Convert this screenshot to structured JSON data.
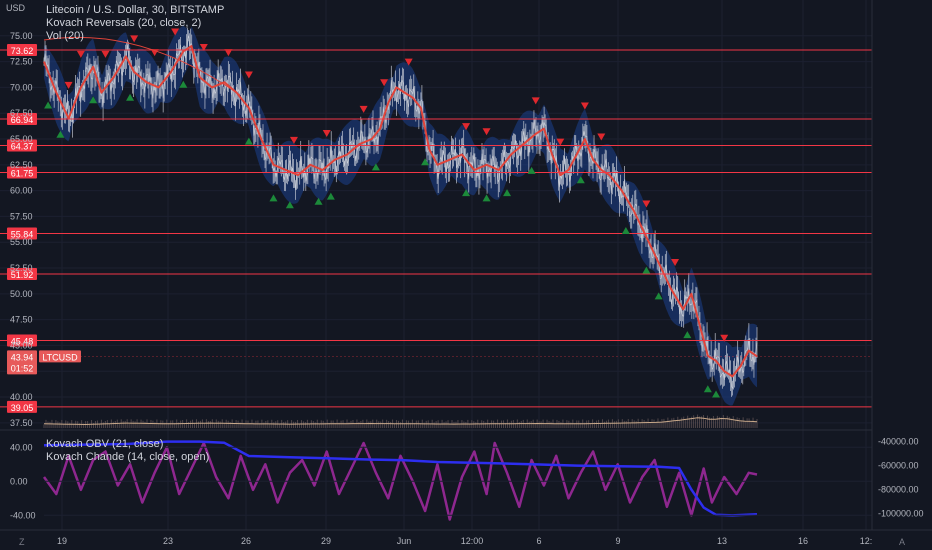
{
  "header": {
    "symbol_title": "Litecoin / U.S. Dollar, 30, BITSTAMP",
    "indicator_reversals": "Kovach Reversals (20, close, 2)",
    "indicator_volume": "Vol (20)"
  },
  "lower_pane": {
    "indicator_obv": "Kovach OBV (21, close)",
    "indicator_chande": "Kovach Chande (14, close, open)"
  },
  "price_axis": {
    "unit": "USD",
    "ticks": [
      "75.00",
      "72.50",
      "70.00",
      "67.50",
      "65.00",
      "62.50",
      "60.00",
      "57.50",
      "55.00",
      "52.50",
      "50.00",
      "47.50",
      "45.00",
      "42.50",
      "40.00",
      "37.50"
    ],
    "level_labels": [
      "73.62",
      "66.94",
      "64.37",
      "61.75",
      "55.84",
      "51.92",
      "45.48",
      "39.05"
    ],
    "current_price": "43.94",
    "symbol_badge": "LTCUSD",
    "countdown": "01:52"
  },
  "lower_axis": {
    "left_ticks": [
      "40.00",
      "0.00",
      "-40.00"
    ],
    "right_ticks": [
      "-40000.00",
      "-60000.00",
      "-80000.00",
      "-100000.00"
    ]
  },
  "time_axis": {
    "labels": [
      "19",
      "23",
      "26",
      "29",
      "Jun",
      "12:00",
      "6",
      "9",
      "13",
      "16",
      "12:"
    ]
  },
  "corner": {
    "left": "Z",
    "right": "A"
  },
  "colors": {
    "background": "#131722",
    "level_line": "#f23645",
    "candle_line": "#cfd3dc",
    "trend_line": "#e0443a",
    "band_fill": "#1c3f8c",
    "up_triangle": "#1c8a3a",
    "down_triangle": "#e0282e",
    "obv_line": "#2d2ef0",
    "chande_line": "#8e278f"
  },
  "chart_data": {
    "type": "line",
    "symbol": "LTCUSD",
    "interval": "30",
    "exchange": "BITSTAMP",
    "y_range": [
      37,
      77.5
    ],
    "horizontal_levels": [
      73.62,
      66.94,
      64.37,
      61.75,
      55.84,
      51.92,
      45.48,
      39.05
    ],
    "price_path": [
      [
        0,
        72.5
      ],
      [
        3,
        69.5
      ],
      [
        6,
        67.0
      ],
      [
        9,
        70.0
      ],
      [
        12,
        72.0
      ],
      [
        14,
        69.5
      ],
      [
        17,
        71.0
      ],
      [
        20,
        73.0
      ],
      [
        22,
        71.5
      ],
      [
        25,
        70.5
      ],
      [
        28,
        70.0
      ],
      [
        31,
        71.5
      ],
      [
        34,
        73.5
      ],
      [
        36,
        74.0
      ],
      [
        38,
        71.0
      ],
      [
        41,
        70.0
      ],
      [
        44,
        70.5
      ],
      [
        47,
        69.5
      ],
      [
        50,
        68.0
      ],
      [
        53,
        65.0
      ],
      [
        56,
        62.5
      ],
      [
        59,
        62.0
      ],
      [
        62,
        61.5
      ],
      [
        65,
        62.5
      ],
      [
        68,
        62.0
      ],
      [
        71,
        63.0
      ],
      [
        74,
        63.5
      ],
      [
        77,
        64.5
      ],
      [
        80,
        65.0
      ],
      [
        82,
        66.0
      ],
      [
        84,
        68.5
      ],
      [
        86,
        70.0
      ],
      [
        88,
        69.5
      ],
      [
        90,
        69.0
      ],
      [
        92,
        68.0
      ],
      [
        94,
        64.0
      ],
      [
        96,
        62.5
      ],
      [
        99,
        63.0
      ],
      [
        102,
        63.5
      ],
      [
        105,
        62.0
      ],
      [
        108,
        62.5
      ],
      [
        111,
        62.0
      ],
      [
        114,
        63.5
      ],
      [
        117,
        64.5
      ],
      [
        120,
        65.5
      ],
      [
        122,
        66.0
      ],
      [
        124,
        63.5
      ],
      [
        126,
        61.5
      ],
      [
        128,
        62.0
      ],
      [
        130,
        63.5
      ],
      [
        132,
        65.0
      ],
      [
        134,
        63.0
      ],
      [
        136,
        62.0
      ],
      [
        138,
        61.5
      ],
      [
        141,
        60.0
      ],
      [
        144,
        58.0
      ],
      [
        147,
        55.5
      ],
      [
        150,
        53.0
      ],
      [
        153,
        50.5
      ],
      [
        156,
        48.5
      ],
      [
        158,
        50.0
      ],
      [
        160,
        47.0
      ],
      [
        162,
        44.0
      ],
      [
        164,
        43.5
      ],
      [
        166,
        42.5
      ],
      [
        168,
        42.0
      ],
      [
        170,
        43.0
      ],
      [
        172,
        44.5
      ],
      [
        174,
        43.94
      ]
    ],
    "volume_series": [
      [
        0,
        0.3
      ],
      [
        10,
        0.25
      ],
      [
        20,
        0.35
      ],
      [
        30,
        0.3
      ],
      [
        40,
        0.35
      ],
      [
        50,
        0.3
      ],
      [
        60,
        0.28
      ],
      [
        70,
        0.3
      ],
      [
        80,
        0.32
      ],
      [
        90,
        0.3
      ],
      [
        100,
        0.28
      ],
      [
        110,
        0.3
      ],
      [
        120,
        0.32
      ],
      [
        130,
        0.3
      ],
      [
        140,
        0.35
      ],
      [
        150,
        0.4
      ],
      [
        155,
        0.55
      ],
      [
        160,
        0.75
      ],
      [
        163,
        0.6
      ],
      [
        166,
        0.7
      ],
      [
        170,
        0.5
      ],
      [
        174,
        0.45
      ]
    ],
    "obv_series": [
      [
        0,
        -43000
      ],
      [
        20,
        -42000
      ],
      [
        30,
        -40000
      ],
      [
        38,
        -40000
      ],
      [
        44,
        -41000
      ],
      [
        50,
        -52000
      ],
      [
        60,
        -53000
      ],
      [
        70,
        -54000
      ],
      [
        80,
        -55000
      ],
      [
        88,
        -55500
      ],
      [
        96,
        -57000
      ],
      [
        110,
        -58000
      ],
      [
        120,
        -59000
      ],
      [
        130,
        -60000
      ],
      [
        140,
        -60500
      ],
      [
        150,
        -61000
      ],
      [
        155,
        -62000
      ],
      [
        158,
        -80000
      ],
      [
        161,
        -95000
      ],
      [
        164,
        -101000
      ],
      [
        168,
        -101500
      ],
      [
        174,
        -100500
      ]
    ],
    "chande_series": [
      [
        0,
        5
      ],
      [
        3,
        -15
      ],
      [
        6,
        30
      ],
      [
        9,
        -10
      ],
      [
        12,
        25
      ],
      [
        15,
        35
      ],
      [
        18,
        -5
      ],
      [
        21,
        20
      ],
      [
        24,
        -25
      ],
      [
        27,
        10
      ],
      [
        30,
        40
      ],
      [
        33,
        -15
      ],
      [
        36,
        15
      ],
      [
        39,
        45
      ],
      [
        42,
        5
      ],
      [
        45,
        -20
      ],
      [
        48,
        30
      ],
      [
        51,
        -10
      ],
      [
        54,
        20
      ],
      [
        57,
        -25
      ],
      [
        60,
        10
      ],
      [
        63,
        25
      ],
      [
        66,
        -5
      ],
      [
        69,
        35
      ],
      [
        72,
        -15
      ],
      [
        75,
        15
      ],
      [
        78,
        45
      ],
      [
        81,
        10
      ],
      [
        84,
        -20
      ],
      [
        87,
        30
      ],
      [
        90,
        0
      ],
      [
        93,
        -35
      ],
      [
        96,
        20
      ],
      [
        99,
        -45
      ],
      [
        102,
        5
      ],
      [
        105,
        35
      ],
      [
        108,
        -15
      ],
      [
        110,
        45
      ],
      [
        113,
        10
      ],
      [
        116,
        -30
      ],
      [
        119,
        25
      ],
      [
        122,
        -5
      ],
      [
        125,
        30
      ],
      [
        128,
        -20
      ],
      [
        131,
        10
      ],
      [
        134,
        35
      ],
      [
        137,
        -10
      ],
      [
        140,
        20
      ],
      [
        143,
        -25
      ],
      [
        146,
        5
      ],
      [
        149,
        25
      ],
      [
        152,
        -30
      ],
      [
        155,
        10
      ],
      [
        158,
        -40
      ],
      [
        161,
        15
      ],
      [
        163,
        -25
      ],
      [
        166,
        5
      ],
      [
        169,
        -15
      ],
      [
        172,
        10
      ],
      [
        174,
        8
      ]
    ],
    "reversal_markers": {
      "up": [
        1,
        4,
        12,
        21,
        34,
        50,
        56,
        60,
        67,
        70,
        81,
        93,
        103,
        108,
        113,
        119,
        131,
        142,
        147,
        150,
        157,
        162,
        164
      ],
      "down": [
        6,
        9,
        15,
        22,
        27,
        32,
        39,
        45,
        50,
        61,
        69,
        78,
        83,
        89,
        103,
        108,
        120,
        126,
        132,
        136,
        147,
        154,
        166
      ]
    },
    "lower_axis_left_range": [
      -55,
      58
    ],
    "lower_axis_right_range": [
      -112000,
      -32000
    ]
  }
}
